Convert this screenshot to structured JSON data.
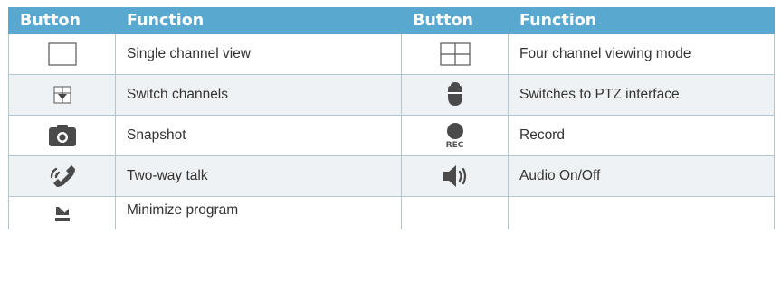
{
  "headers": {
    "button1": "Button",
    "function1": "Function",
    "button2": "Button",
    "function2": "Function"
  },
  "rows": [
    {
      "left": {
        "icon": "single-channel-icon",
        "function": "Single channel view"
      },
      "right": {
        "icon": "four-channel-grid-icon",
        "function": "Four channel viewing mode"
      }
    },
    {
      "left": {
        "icon": "switch-channels-icon",
        "function": "Switch channels"
      },
      "right": {
        "icon": "ptz-camera-icon",
        "function": "Switches to PTZ interface"
      }
    },
    {
      "left": {
        "icon": "camera-snapshot-icon",
        "function": "Snapshot"
      },
      "right": {
        "icon": "record-icon",
        "icon_label": "REC",
        "function": "Record"
      }
    },
    {
      "left": {
        "icon": "phone-talk-icon",
        "function": "Two-way talk"
      },
      "right": {
        "icon": "speaker-icon",
        "function": "Audio On/Off"
      }
    },
    {
      "left": {
        "icon": "minimize-icon",
        "function": "Minimize program"
      },
      "right": {
        "icon": "",
        "function": ""
      }
    }
  ],
  "colors": {
    "header_bg": "#58a8cf",
    "icon_color": "#4a4a4a",
    "row_alt_bg": "#eef2f4"
  }
}
